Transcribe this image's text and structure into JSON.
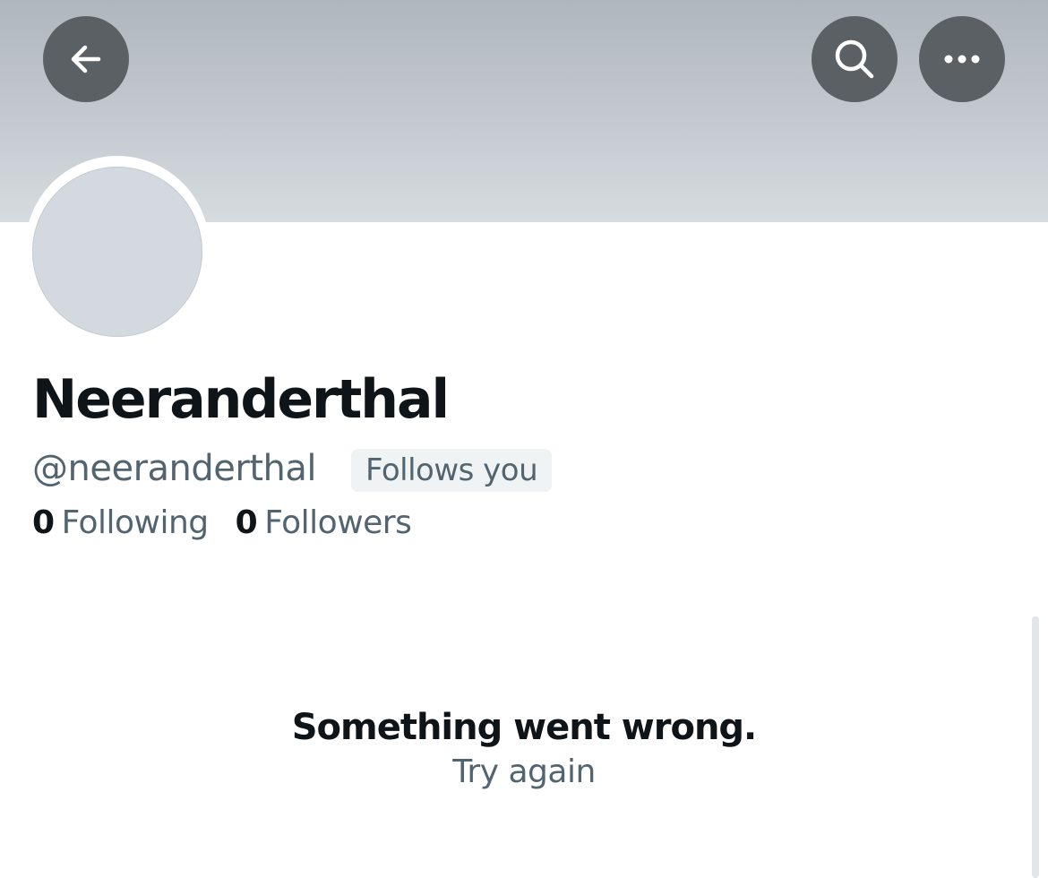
{
  "header": {
    "back_icon": "arrow-left-icon",
    "search_icon": "search-icon",
    "more_icon": "more-horizontal-icon",
    "button_color": "#5b6064"
  },
  "profile": {
    "display_name": "Neeranderthal",
    "handle": "@neeranderthal",
    "follows_you_badge": "Follows you",
    "following_count": "0",
    "following_label": "Following",
    "followers_count": "0",
    "followers_label": "Followers"
  },
  "error": {
    "title": "Something went wrong.",
    "retry_label": "Try again"
  },
  "colors": {
    "primary_text": "#0f1419",
    "secondary_text": "#536471",
    "badge_bg": "#eff3f4",
    "avatar_placeholder": "#d3d9df"
  }
}
